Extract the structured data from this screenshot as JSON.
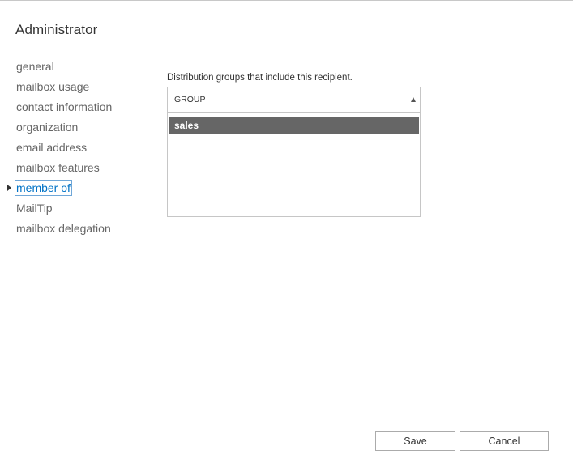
{
  "title": "Administrator",
  "nav": {
    "items": [
      {
        "label": "general",
        "selected": false
      },
      {
        "label": "mailbox usage",
        "selected": false
      },
      {
        "label": "contact information",
        "selected": false
      },
      {
        "label": "organization",
        "selected": false
      },
      {
        "label": "email address",
        "selected": false
      },
      {
        "label": "mailbox features",
        "selected": false
      },
      {
        "label": "member of",
        "selected": true
      },
      {
        "label": "MailTip",
        "selected": false
      },
      {
        "label": "mailbox delegation",
        "selected": false
      }
    ]
  },
  "member_of": {
    "caption": "Distribution groups that include this recipient.",
    "column_header": "GROUP",
    "sort": "ascending",
    "rows": [
      {
        "name": "sales",
        "selected": true
      }
    ]
  },
  "buttons": {
    "save": "Save",
    "cancel": "Cancel"
  },
  "colors": {
    "accent": "#0072c6",
    "selected_row_bg": "#666666",
    "text": "#333333",
    "muted_text": "#666666"
  }
}
